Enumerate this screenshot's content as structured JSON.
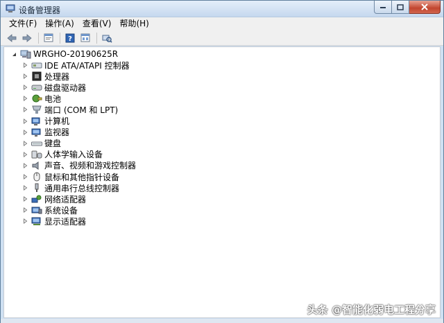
{
  "window": {
    "title": "设备管理器"
  },
  "menu": [
    "文件(F)",
    "操作(A)",
    "查看(V)",
    "帮助(H)"
  ],
  "toolbar": {
    "icons": [
      "back-arrow-icon",
      "forward-arrow-icon",
      "properties-icon",
      "help-icon",
      "update-driver-icon",
      "scan-hardware-icon"
    ]
  },
  "tree": {
    "root": "WRGHO-20190625R",
    "items": [
      {
        "label": "IDE ATA/ATAPI 控制器",
        "icon": "ide-controller-icon"
      },
      {
        "label": "处理器",
        "icon": "processor-icon"
      },
      {
        "label": "磁盘驱动器",
        "icon": "disk-drive-icon"
      },
      {
        "label": "电池",
        "icon": "battery-icon"
      },
      {
        "label": "端口 (COM 和 LPT)",
        "icon": "port-icon"
      },
      {
        "label": "计算机",
        "icon": "computer-icon"
      },
      {
        "label": "监视器",
        "icon": "monitor-icon"
      },
      {
        "label": "键盘",
        "icon": "keyboard-icon"
      },
      {
        "label": "人体学输入设备",
        "icon": "hid-icon"
      },
      {
        "label": "声音、视频和游戏控制器",
        "icon": "sound-icon"
      },
      {
        "label": "鼠标和其他指针设备",
        "icon": "mouse-icon"
      },
      {
        "label": "通用串行总线控制器",
        "icon": "usb-icon"
      },
      {
        "label": "网络适配器",
        "icon": "network-icon"
      },
      {
        "label": "系统设备",
        "icon": "system-device-icon"
      },
      {
        "label": "显示适配器",
        "icon": "display-adapter-icon"
      }
    ]
  },
  "watermark": "头条 @智能化弱电工程分享"
}
